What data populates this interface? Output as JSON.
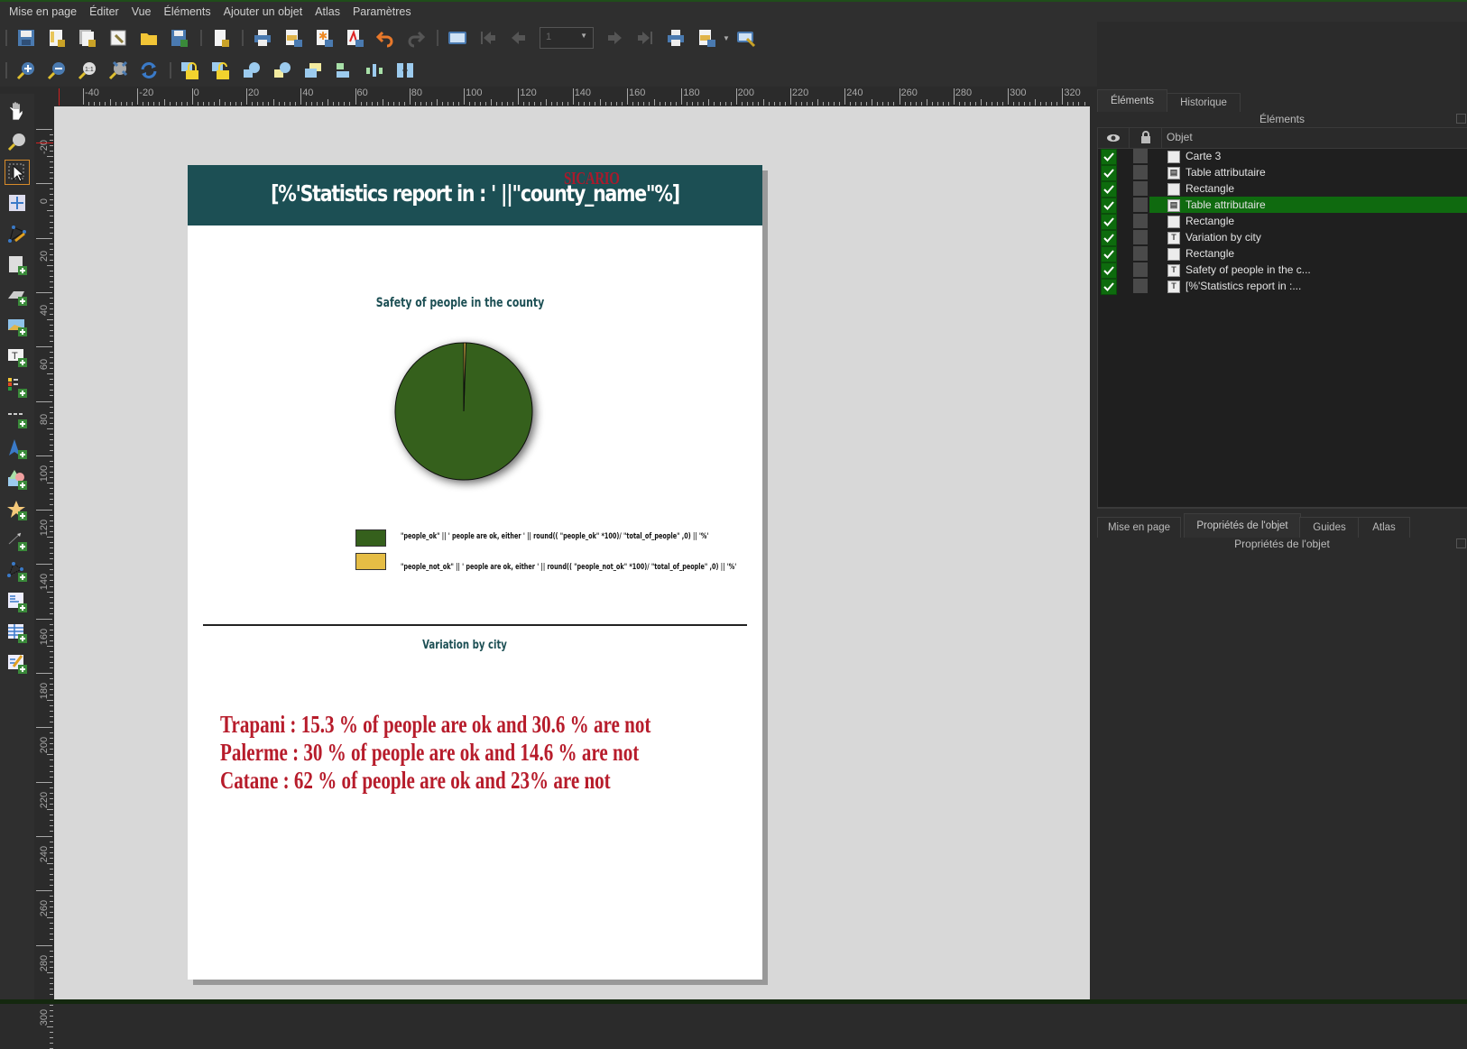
{
  "menu": [
    "Mise en page",
    "Éditer",
    "Vue",
    "Éléments",
    "Ajouter un objet",
    "Atlas",
    "Paramètres"
  ],
  "toolbar1": {
    "icons": [
      "save-icon",
      "new-layout-icon",
      "duplicate-layout-icon",
      "layout-manager-icon",
      "open-template-icon",
      "save-as-template-icon",
      "new-report-icon",
      "print-icon",
      "export-image-icon",
      "export-svg-icon",
      "export-pdf-icon",
      "undo-icon",
      "redo-icon",
      "atlas-preview-icon",
      "first-feature-icon",
      "previous-feature-icon",
      "next-feature-icon",
      "last-feature-icon",
      "atlas-print-icon",
      "atlas-export-image-icon",
      "atlas-settings-icon"
    ],
    "atlas_page_value": "1"
  },
  "toolbar2": {
    "icons": [
      "zoom-in-icon",
      "zoom-out-icon",
      "zoom-100-icon",
      "zoom-full-icon",
      "refresh-icon",
      "lock-items-icon",
      "unlock-items-icon",
      "group-icon",
      "ungroup-icon",
      "raise-items-icon",
      "align-items-icon",
      "distribute-items-icon",
      "resize-items-icon"
    ]
  },
  "left_tools": [
    "pan-icon",
    "zoom-tool-icon",
    "select-move-icon",
    "move-content-icon",
    "edit-nodes-icon",
    "add-map-icon",
    "add-3d-map-icon",
    "add-picture-icon",
    "add-label-icon",
    "add-legend-icon",
    "add-scalebar-icon",
    "add-north-arrow-icon",
    "add-shape-icon",
    "add-marker-icon",
    "add-arrow-icon",
    "add-node-item-icon",
    "add-html-icon",
    "add-attribute-table-icon",
    "add-fixed-table-icon"
  ],
  "rulers": {
    "horizontal": [
      "-40",
      "-20",
      "0",
      "20",
      "40",
      "60",
      "80",
      "100",
      "120",
      "140",
      "160",
      "180",
      "200",
      "220",
      "240",
      "260",
      "280",
      "300",
      "320"
    ],
    "vertical": [
      "-20",
      "0",
      "20",
      "40",
      "60",
      "80",
      "100",
      "120",
      "140",
      "160",
      "180",
      "200",
      "220",
      "240",
      "260",
      "280",
      "300"
    ]
  },
  "layout": {
    "header_title": "[%'Statistics report in : ' ||\"county_name\"%]",
    "watermark": "SICARIO",
    "chart_title": "Safety of people in the county",
    "legend": [
      {
        "color": "#35601c",
        "label": "\"people_ok\"  || ' people are ok, either ' || round((  \"people_ok\" *100)/  \"total_of_people\" ,0) || '%'"
      },
      {
        "color": "#e5bd45",
        "label": "\"people_not_ok\"  || ' people are ok, either ' || round((  \"people_not_ok\" *100)/  \"total_of_people\" ,0) || '%'"
      }
    ],
    "section_title": "Variation by city",
    "city_lines": [
      "Trapani : 15.3 % of people are ok and 30.6 % are not",
      "Palerme : 30 % of people are ok and 14.6 % are not",
      "Catane : 62 % of people are ok and 23% are not"
    ]
  },
  "chart_data": {
    "type": "pie",
    "title": "Safety of people in the county",
    "categories": [
      "people_ok",
      "people_not_ok"
    ],
    "values": [
      99.5,
      0.5
    ],
    "colors": [
      "#35601c",
      "#e5bd45"
    ]
  },
  "right_panel": {
    "top_tabs": [
      "Éléments",
      "Historique"
    ],
    "top_panel_title": "Éléments",
    "columns": [
      "visible-icon",
      "lock-icon",
      "Objet"
    ],
    "items": [
      {
        "name": "Carte 3",
        "type": "map",
        "visible": true,
        "selected": false
      },
      {
        "name": "Table attributaire",
        "type": "table",
        "visible": true,
        "selected": false
      },
      {
        "name": "Rectangle",
        "type": "shape",
        "visible": true,
        "selected": false
      },
      {
        "name": "Table attributaire",
        "type": "table",
        "visible": true,
        "selected": true
      },
      {
        "name": "Rectangle",
        "type": "shape",
        "visible": true,
        "selected": false
      },
      {
        "name": "Variation by city",
        "type": "label",
        "visible": true,
        "selected": false
      },
      {
        "name": "Rectangle",
        "type": "shape",
        "visible": true,
        "selected": false
      },
      {
        "name": "Safety of people in the c...",
        "type": "label",
        "visible": true,
        "selected": false
      },
      {
        "name": "[%'Statistics report in :...",
        "type": "label",
        "visible": true,
        "selected": false
      }
    ],
    "bottom_tabs": [
      "Mise en page",
      "Propriétés de l'objet",
      "Guides",
      "Atlas"
    ],
    "bottom_panel_title": "Propriétés de l'objet"
  }
}
